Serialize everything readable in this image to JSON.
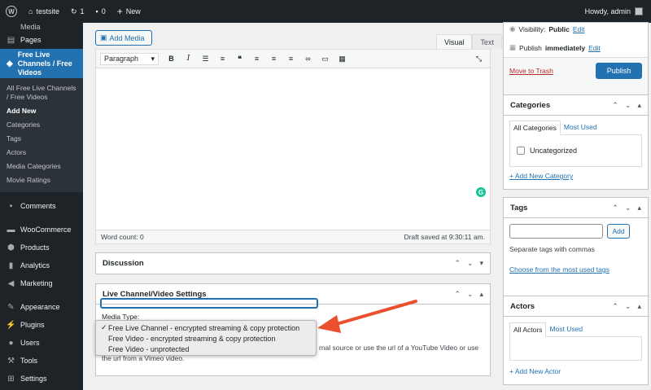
{
  "adminbar": {
    "site_name": "testsite",
    "updates_count": "1",
    "comments_count": "0",
    "new_label": "New",
    "howdy": "Howdy, admin"
  },
  "sidebar": {
    "top_items": [
      {
        "label": "Media"
      },
      {
        "label": "Pages"
      }
    ],
    "active_item": "Free Live Channels / Free Videos",
    "submenu": [
      "All Free Live Channels / Free Videos",
      "Add New",
      "Categories",
      "Tags",
      "Actors",
      "Media Categories",
      "Movie Ratings"
    ],
    "bottom_items": [
      "Comments",
      "WooCommerce",
      "Products",
      "Analytics",
      "Marketing",
      "Appearance",
      "Plugins",
      "Users",
      "Tools",
      "Settings"
    ]
  },
  "editor": {
    "add_media_label": "Add Media",
    "tab_visual": "Visual",
    "tab_text": "Text",
    "format_value": "Paragraph",
    "word_count": "Word count: 0",
    "draft_saved": "Draft saved at 9:30:11 am."
  },
  "discussion": {
    "title": "Discussion"
  },
  "live_settings": {
    "title": "Live Channel/Video Settings",
    "media_type_label": "Media Type:",
    "options": [
      "Free Live Channel - encrypted streaming & copy protection",
      "Free Video - encrypted streaming & copy protection",
      "Free Video - unprotected"
    ],
    "selected_index": 0,
    "help_text_1": "rnal source or use the url of a YouTube Video or use",
    "help_text_2": "the url from a Vimeo video."
  },
  "publish_box": {
    "visibility_label": "Visibility:",
    "visibility_value": "Public",
    "visibility_edit": "Edit",
    "publish_label": "Publish",
    "publish_value": "immediately",
    "publish_edit": "Edit",
    "trash": "Move to Trash",
    "publish_button": "Publish"
  },
  "categories": {
    "title": "Categories",
    "tab_all": "All Categories",
    "tab_used": "Most Used",
    "item": "Uncategorized",
    "add_link": "+ Add New Category"
  },
  "tags": {
    "title": "Tags",
    "add_button": "Add",
    "hint": "Separate tags with commas",
    "choose_link": "Choose from the most used tags"
  },
  "actors": {
    "title": "Actors",
    "tab_all": "All Actors",
    "tab_used": "Most Used",
    "add_link": "+ Add New Actor"
  },
  "colors": {
    "accent": "#2271b1",
    "sidebar_bg": "#1d2327",
    "arrow": "#ea4f2e"
  }
}
